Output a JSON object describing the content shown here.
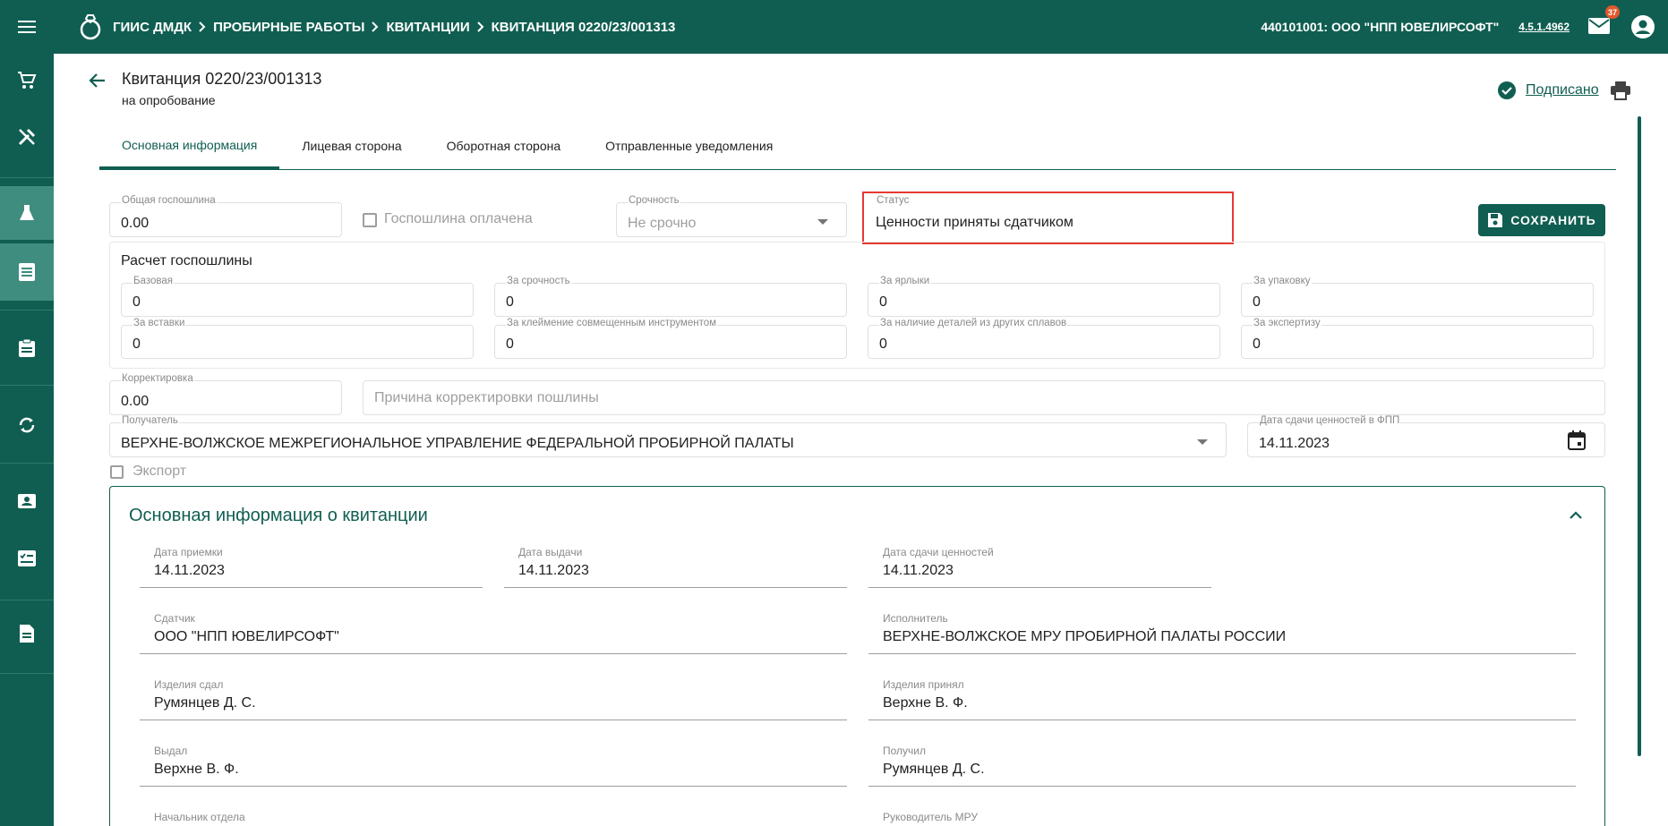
{
  "topbar": {
    "app_name": "ГИИС ДМДК",
    "breadcrumbs": [
      "ПРОБИРНЫЕ РАБОТЫ",
      "КВИТАНЦИИ",
      "КВИТАНЦИЯ 0220/23/001313"
    ],
    "organization": "440101001: ООО \"НПП ЮВЕЛИРСОФТ\"",
    "version": "4.5.1.4962",
    "mail_count": "37",
    "brand_color": "#105e51"
  },
  "sidebar": {
    "items": [
      "cart-icon",
      "tools-icon",
      "flask-icon",
      "receipt-icon",
      "clipboard-icon",
      "sync-icon",
      "contact-card-icon",
      "checklist-icon",
      "document-icon"
    ],
    "active": [
      "flask-icon",
      "receipt-icon"
    ]
  },
  "header": {
    "title": "Квитанция 0220/23/001313",
    "subtitle": "на опробование",
    "signed_label": "Подписано"
  },
  "tabs": [
    "Основная информация",
    "Лицевая сторона",
    "Оборотная сторона",
    "Отправленные уведомления"
  ],
  "active_tab": "Основная информация",
  "form": {
    "total_fee": {
      "label": "Общая госпошлина",
      "value": "0.00"
    },
    "fee_paid": {
      "label": "Госпошлина оплачена",
      "checked": false
    },
    "urgency": {
      "label": "Срочность",
      "value": "Не срочно"
    },
    "status": {
      "label": "Статус",
      "value": "Ценности приняты сдатчиком"
    },
    "save_label": "СОХРАНИТЬ",
    "fee_calc": {
      "title": "Расчет госпошлины",
      "fields": [
        {
          "label": "Базовая",
          "value": "0"
        },
        {
          "label": "За срочность",
          "value": "0"
        },
        {
          "label": "За ярлыки",
          "value": "0"
        },
        {
          "label": "За упаковку",
          "value": "0"
        },
        {
          "label": "За вставки",
          "value": "0"
        },
        {
          "label": "За клеймение совмещенным инструментом",
          "value": "0"
        },
        {
          "label": "За наличие деталей из других сплавов",
          "value": "0"
        },
        {
          "label": "За экспертизу",
          "value": "0"
        }
      ]
    },
    "correction": {
      "label": "Корректировка",
      "value": "0.00"
    },
    "correction_reason": {
      "placeholder": "Причина корректировки пошлины"
    },
    "recipient": {
      "label": "Получатель",
      "value": "ВЕРХНЕ-ВОЛЖСКОЕ МЕЖРЕГИОНАЛЬНОЕ УПРАВЛЕНИЕ ФЕДЕРАЛЬНОЙ ПРОБИРНОЙ ПАЛАТЫ"
    },
    "handover_date": {
      "label": "Дата сдачи ценностей в ФПП",
      "value": "14.11.2023"
    },
    "export": {
      "label": "Экспорт",
      "checked": false
    }
  },
  "info": {
    "title": "Основная информация о квитанции",
    "receive_date": {
      "label": "Дата приемки",
      "value": "14.11.2023"
    },
    "issue_date": {
      "label": "Дата выдачи",
      "value": "14.11.2023"
    },
    "valuables_date": {
      "label": "Дата сдачи ценностей",
      "value": "14.11.2023"
    },
    "depositor": {
      "label": "Сдатчик",
      "value": "ООО \"НПП ЮВЕЛИРСОФТ\""
    },
    "executor": {
      "label": "Исполнитель",
      "value": "ВЕРХНЕ-ВОЛЖСКОЕ МРУ ПРОБИРНОЙ ПАЛАТЫ РОССИИ"
    },
    "items_given": {
      "label": "Изделия сдал",
      "value": "Румянцев Д. С."
    },
    "items_accepted": {
      "label": "Изделия принял",
      "value": "Верхне В. Ф."
    },
    "issued_by": {
      "label": "Выдал",
      "value": "Верхне В. Ф."
    },
    "received_by": {
      "label": "Получил",
      "value": "Румянцев Д. С."
    },
    "dept_head": {
      "label": "Начальник отдела"
    },
    "mru_head": {
      "label": "Руководитель МРУ"
    }
  }
}
